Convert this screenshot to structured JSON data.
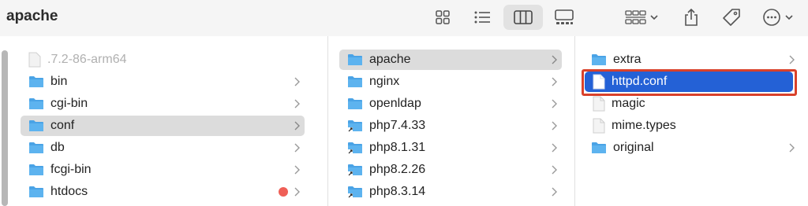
{
  "window": {
    "title": "apache"
  },
  "toolbar": {
    "view_icons": "icon-view-icon",
    "view_list": "list-view-icon",
    "view_columns": "column-view-icon",
    "view_gallery": "gallery-view-icon",
    "group": "group-icon",
    "share": "share-icon",
    "tag": "tag-icon",
    "more": "more-icon"
  },
  "columns": [
    {
      "items": [
        {
          "label": ".7.2-86-arm64",
          "icon": "file-icon",
          "dimmed": true,
          "chevron": false
        },
        {
          "label": "bin",
          "icon": "folder-icon",
          "chevron": true
        },
        {
          "label": "cgi-bin",
          "icon": "folder-icon",
          "chevron": true
        },
        {
          "label": "conf",
          "icon": "folder-icon",
          "chevron": true,
          "selected": "grey"
        },
        {
          "label": "db",
          "icon": "folder-icon",
          "chevron": true
        },
        {
          "label": "fcgi-bin",
          "icon": "folder-icon",
          "chevron": true
        },
        {
          "label": "htdocs",
          "icon": "folder-icon",
          "chevron": true,
          "tag_color": "#ef5f57"
        }
      ]
    },
    {
      "items": [
        {
          "label": "apache",
          "icon": "folder-icon",
          "chevron": true,
          "selected": "grey"
        },
        {
          "label": "nginx",
          "icon": "folder-icon",
          "chevron": true
        },
        {
          "label": "openldap",
          "icon": "folder-icon",
          "chevron": true
        },
        {
          "label": "php7.4.33",
          "icon": "folder-alias-icon",
          "chevron": true
        },
        {
          "label": "php8.1.31",
          "icon": "folder-alias-icon",
          "chevron": true
        },
        {
          "label": "php8.2.26",
          "icon": "folder-alias-icon",
          "chevron": true
        },
        {
          "label": "php8.3.14",
          "icon": "folder-alias-icon",
          "chevron": true
        }
      ]
    },
    {
      "items": [
        {
          "label": "extra",
          "icon": "folder-icon",
          "chevron": true
        },
        {
          "label": "httpd.conf",
          "icon": "file-icon",
          "chevron": false,
          "selected": "blue"
        },
        {
          "label": "magic",
          "icon": "file-icon",
          "chevron": false
        },
        {
          "label": "mime.types",
          "icon": "file-icon",
          "chevron": false
        },
        {
          "label": "original",
          "icon": "folder-icon",
          "chevron": true
        }
      ]
    }
  ],
  "colors": {
    "folder": "#4aa3e6",
    "selection_blue": "#2461d6",
    "selection_grey": "#dcdcdc",
    "annotation_red": "#d9412b",
    "tag_red": "#ef5f57"
  }
}
